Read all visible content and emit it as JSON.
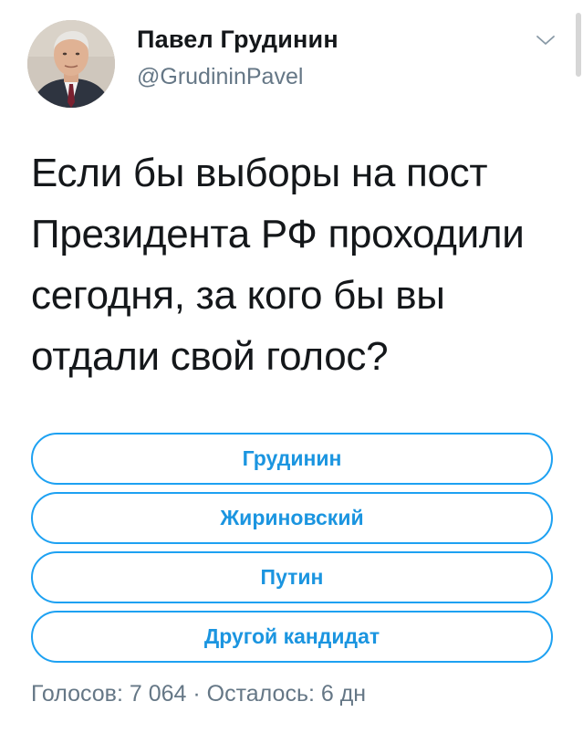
{
  "author": {
    "name": "Павел Грудинин",
    "handle": "@GrudininPavel"
  },
  "icons": {
    "avatar": "profile-photo",
    "menu": "chevron-down-icon"
  },
  "tweet": {
    "lines": [
      "Если бы выборы на пост",
      "Президента РФ проходили",
      "сегодня, за кого бы вы",
      "отдали свой голос?"
    ]
  },
  "poll": {
    "options": [
      "Грудинин",
      "Жириновский",
      "Путин",
      "Другой кандидат"
    ],
    "votes_text": "Голосов: 7 064",
    "separator": "·",
    "remaining_text": "Осталось: 6 дн"
  },
  "colors": {
    "accent": "#1da1f2",
    "option_text": "#1b95e0",
    "secondary_text": "#657786",
    "primary_text": "#14171a"
  }
}
